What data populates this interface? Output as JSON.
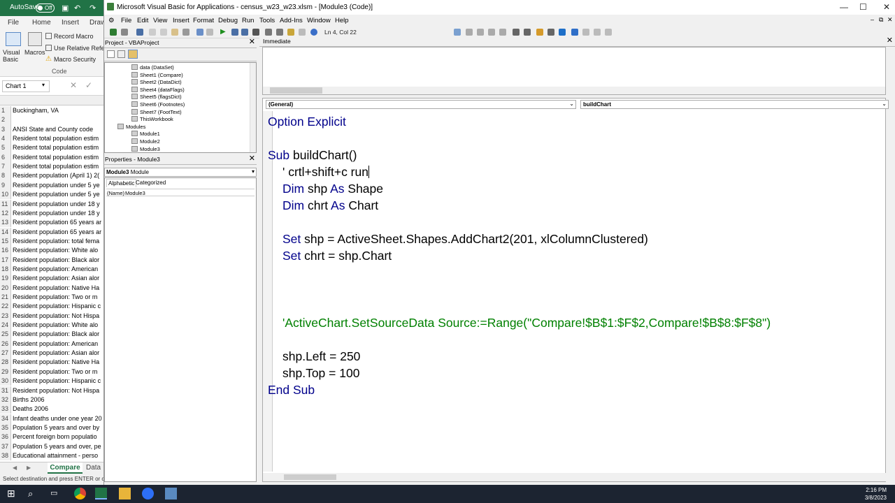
{
  "excel": {
    "autosave_label": "AutoSave",
    "autosave_state": "Off",
    "tabs": [
      "File",
      "Home",
      "Insert",
      "Draw"
    ],
    "ribbon": {
      "visual_basic": "Visual Basic",
      "macros": "Macros",
      "record_macro": "Record Macro",
      "use_relative": "Use Relative References",
      "macro_security": "Macro Security",
      "group_label": "Code"
    },
    "name_box": "Chart 1",
    "rows": [
      {
        "n": "1",
        "v": "Buckingham,  VA"
      },
      {
        "n": "2",
        "v": ""
      },
      {
        "n": "3",
        "v": "ANSI State and County code"
      },
      {
        "n": "4",
        "v": "Resident total population estim"
      },
      {
        "n": "5",
        "v": "Resident total population estim"
      },
      {
        "n": "6",
        "v": "Resident total population estim"
      },
      {
        "n": "7",
        "v": "Resident total population estim"
      },
      {
        "n": "8",
        "v": "Resident population (April 1) 2("
      },
      {
        "n": "9",
        "v": "Resident population under 5 ye"
      },
      {
        "n": "10",
        "v": "Resident population under 5 ye"
      },
      {
        "n": "11",
        "v": "Resident population under 18 y"
      },
      {
        "n": "12",
        "v": "Resident population under 18 y"
      },
      {
        "n": "13",
        "v": "Resident population 65 years ar"
      },
      {
        "n": "14",
        "v": "Resident population 65 years ar"
      },
      {
        "n": "15",
        "v": "Resident population: total fema"
      },
      {
        "n": "16",
        "v": "Resident population: White alo"
      },
      {
        "n": "17",
        "v": "Resident population: Black alor"
      },
      {
        "n": "18",
        "v": "Resident population: American"
      },
      {
        "n": "19",
        "v": "Resident population: Asian alor"
      },
      {
        "n": "20",
        "v": "Resident population: Native Ha"
      },
      {
        "n": "21",
        "v": "Resident population: Two or m"
      },
      {
        "n": "22",
        "v": "Resident population: Hispanic c"
      },
      {
        "n": "23",
        "v": "Resident population: Not Hispa"
      },
      {
        "n": "24",
        "v": "Resident population: White alo"
      },
      {
        "n": "25",
        "v": "Resident population: Black alor"
      },
      {
        "n": "26",
        "v": "Resident population: American"
      },
      {
        "n": "27",
        "v": "Resident population: Asian alor"
      },
      {
        "n": "28",
        "v": "Resident population: Native Ha"
      },
      {
        "n": "29",
        "v": "Resident population: Two or m"
      },
      {
        "n": "30",
        "v": "Resident population: Hispanic c"
      },
      {
        "n": "31",
        "v": "Resident population: Not Hispa"
      },
      {
        "n": "32",
        "v": "Births 2006"
      },
      {
        "n": "33",
        "v": "Deaths 2006"
      },
      {
        "n": "34",
        "v": "Infant deaths under one year 20"
      },
      {
        "n": "35",
        "v": "Population 5 years and over by"
      },
      {
        "n": "36",
        "v": "Percent foreign born populatio"
      },
      {
        "n": "37",
        "v": "Population 5 years and over, pe"
      },
      {
        "n": "38",
        "v": "Educational attainment - perso"
      }
    ],
    "sheet_tabs": {
      "active": "Compare",
      "next": "Data"
    },
    "status": "Select destination and press ENTER or ch"
  },
  "vbe": {
    "title": "Microsoft Visual Basic for Applications - census_w23_w23.xlsm - [Module3 (Code)]",
    "menu": [
      "File",
      "Edit",
      "View",
      "Insert",
      "Format",
      "Debug",
      "Run",
      "Tools",
      "Add-Ins",
      "Window",
      "Help"
    ],
    "cursor_pos": "Ln 4, Col 22",
    "project_title": "Project - VBAProject",
    "tree": [
      {
        "label": "data (DataSet)",
        "indent": 2
      },
      {
        "label": "Sheet1 (Compare)",
        "indent": 2
      },
      {
        "label": "Sheet2 (DataDict)",
        "indent": 2
      },
      {
        "label": "Sheet4 (dataFlags)",
        "indent": 2
      },
      {
        "label": "Sheet5 (flagsDict)",
        "indent": 2
      },
      {
        "label": "Sheet6 (Footnotes)",
        "indent": 2
      },
      {
        "label": "Sheet7 (FootText)",
        "indent": 2
      },
      {
        "label": "ThisWorkbook",
        "indent": 2
      },
      {
        "label": "Modules",
        "indent": 1
      },
      {
        "label": "Module1",
        "indent": 2
      },
      {
        "label": "Module2",
        "indent": 2
      },
      {
        "label": "Module3",
        "indent": 2
      }
    ],
    "properties_title": "Properties - Module3",
    "prop_object": "Module3",
    "prop_object_type": "Module",
    "prop_tabs": [
      "Alphabetic",
      "Categorized"
    ],
    "prop_name_key": "(Name)",
    "prop_name_val": "Module3",
    "immediate_title": "Immediate",
    "object_dropdown": "(General)",
    "proc_dropdown": "buildChart",
    "code_lines": [
      {
        "i": 0,
        "parts": [
          {
            "t": "Option Explicit",
            "c": "kw"
          }
        ]
      },
      {
        "i": 0,
        "parts": []
      },
      {
        "i": 0,
        "parts": [
          {
            "t": "Sub ",
            "c": "kw"
          },
          {
            "t": "buildChart()",
            "c": ""
          }
        ]
      },
      {
        "i": 1,
        "parts": [
          {
            "t": "' crtl+shift+c run",
            "c": ""
          }
        ]
      },
      {
        "i": 1,
        "parts": [
          {
            "t": "Dim ",
            "c": "kw"
          },
          {
            "t": "shp ",
            "c": ""
          },
          {
            "t": "As ",
            "c": "kw"
          },
          {
            "t": "Shape",
            "c": ""
          }
        ]
      },
      {
        "i": 1,
        "parts": [
          {
            "t": "Dim ",
            "c": "kw"
          },
          {
            "t": "chrt ",
            "c": ""
          },
          {
            "t": "As ",
            "c": "kw"
          },
          {
            "t": "Chart",
            "c": ""
          }
        ]
      },
      {
        "i": 0,
        "parts": []
      },
      {
        "i": 1,
        "parts": [
          {
            "t": "Set ",
            "c": "kw"
          },
          {
            "t": "shp = ActiveSheet.Shapes.AddChart2(201, xlColumnClustered)",
            "c": ""
          }
        ]
      },
      {
        "i": 1,
        "parts": [
          {
            "t": "Set ",
            "c": "kw"
          },
          {
            "t": "chrt = shp.Chart",
            "c": ""
          }
        ]
      },
      {
        "i": 0,
        "parts": []
      },
      {
        "i": 0,
        "parts": []
      },
      {
        "i": 0,
        "parts": []
      },
      {
        "i": 1,
        "parts": [
          {
            "t": "'ActiveChart.SetSourceData Source:=Range(\"Compare!$B$1:$F$2,Compare!$B$8:$F$8\")",
            "c": "cm"
          }
        ]
      },
      {
        "i": 0,
        "parts": []
      },
      {
        "i": 1,
        "parts": [
          {
            "t": "shp.Left = 250",
            "c": ""
          }
        ]
      },
      {
        "i": 1,
        "parts": [
          {
            "t": "shp.Top = 100",
            "c": ""
          }
        ]
      },
      {
        "i": 0,
        "parts": [
          {
            "t": "End Sub",
            "c": "kw"
          }
        ]
      }
    ]
  },
  "clock": {
    "time": "2:16 PM",
    "date": "3/8/2023"
  },
  "colors": {
    "excel_green": "#217346",
    "keyword": "#00008b",
    "comment": "#008000",
    "taskbar": "#1c2431"
  }
}
